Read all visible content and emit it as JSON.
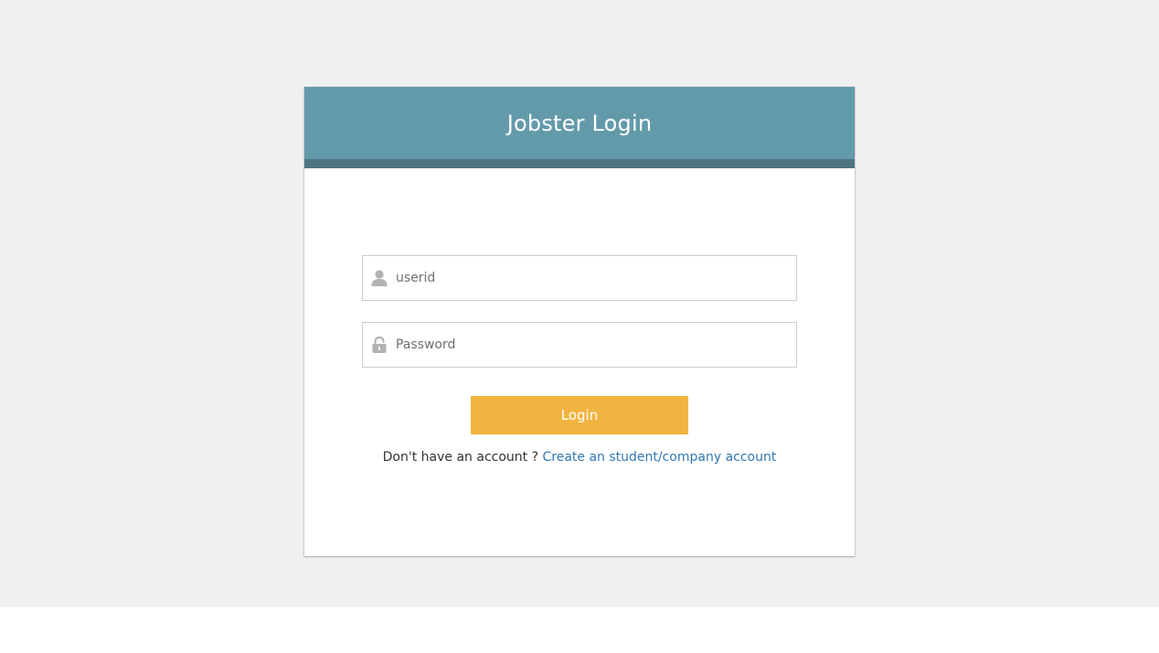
{
  "header": {
    "title": "Jobster Login"
  },
  "form": {
    "userid_placeholder": "userid",
    "userid_value": "",
    "password_placeholder": "Password",
    "password_value": "",
    "login_label": "Login"
  },
  "signup": {
    "prompt": "Don't have an account ?",
    "link_label": "Create an student/company account"
  },
  "icons": {
    "userid": "user-icon",
    "password": "lock-icon"
  },
  "colors": {
    "page_background": "#f0f0f0",
    "header": "#639aaa",
    "header_bar": "#4d7581",
    "login_button": "#f2b441",
    "link": "#3278b3"
  }
}
